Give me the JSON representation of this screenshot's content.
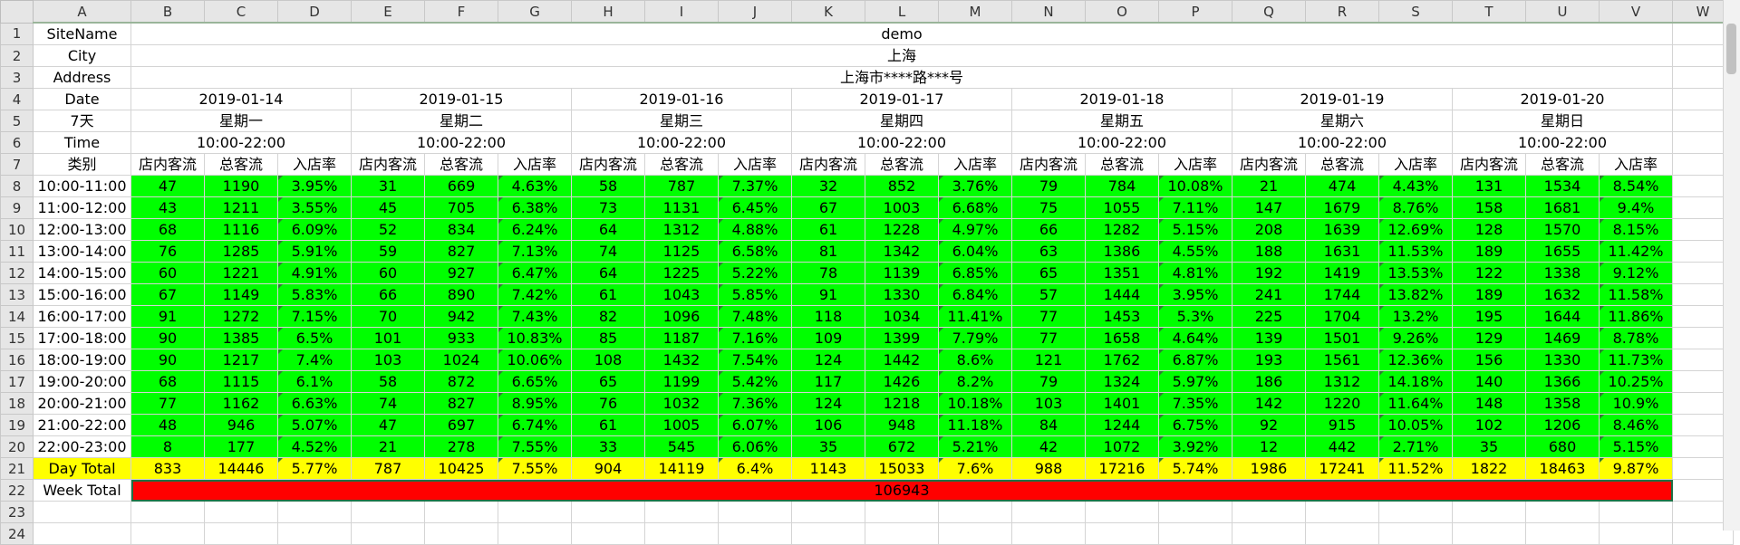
{
  "columns": [
    "A",
    "B",
    "C",
    "D",
    "E",
    "F",
    "G",
    "H",
    "I",
    "J",
    "K",
    "L",
    "M",
    "N",
    "O",
    "P",
    "Q",
    "R",
    "S",
    "T",
    "U",
    "V",
    "W"
  ],
  "row_numbers": [
    1,
    2,
    3,
    4,
    5,
    6,
    7,
    8,
    9,
    10,
    11,
    12,
    13,
    14,
    15,
    16,
    17,
    18,
    19,
    20,
    21,
    22,
    23,
    24
  ],
  "labels": {
    "site_name": "SiteName",
    "city": "City",
    "address": "Address",
    "date": "Date",
    "week_label": "7天",
    "time": "Time",
    "category": "类别",
    "day_total": "Day Total",
    "week_total": "Week Total"
  },
  "site": {
    "name": "demo",
    "city": "上海",
    "address": "上海市****路***号"
  },
  "days": [
    {
      "date": "2019-01-14",
      "weekday": "星期一",
      "hours": "10:00-22:00"
    },
    {
      "date": "2019-01-15",
      "weekday": "星期二",
      "hours": "10:00-22:00"
    },
    {
      "date": "2019-01-16",
      "weekday": "星期三",
      "hours": "10:00-22:00"
    },
    {
      "date": "2019-01-17",
      "weekday": "星期四",
      "hours": "10:00-22:00"
    },
    {
      "date": "2019-01-18",
      "weekday": "星期五",
      "hours": "10:00-22:00"
    },
    {
      "date": "2019-01-19",
      "weekday": "星期六",
      "hours": "10:00-22:00"
    },
    {
      "date": "2019-01-20",
      "weekday": "星期日",
      "hours": "10:00-22:00"
    }
  ],
  "sub_headers": [
    "店内客流",
    "总客流",
    "入店率"
  ],
  "time_slots": [
    {
      "slot": "10:00-11:00",
      "cells": [
        [
          "47",
          "1190",
          "3.95%"
        ],
        [
          "31",
          "669",
          "4.63%"
        ],
        [
          "58",
          "787",
          "7.37%"
        ],
        [
          "32",
          "852",
          "3.76%"
        ],
        [
          "79",
          "784",
          "10.08%"
        ],
        [
          "21",
          "474",
          "4.43%"
        ],
        [
          "131",
          "1534",
          "8.54%"
        ]
      ]
    },
    {
      "slot": "11:00-12:00",
      "cells": [
        [
          "43",
          "1211",
          "3.55%"
        ],
        [
          "45",
          "705",
          "6.38%"
        ],
        [
          "73",
          "1131",
          "6.45%"
        ],
        [
          "67",
          "1003",
          "6.68%"
        ],
        [
          "75",
          "1055",
          "7.11%"
        ],
        [
          "147",
          "1679",
          "8.76%"
        ],
        [
          "158",
          "1681",
          "9.4%"
        ]
      ]
    },
    {
      "slot": "12:00-13:00",
      "cells": [
        [
          "68",
          "1116",
          "6.09%"
        ],
        [
          "52",
          "834",
          "6.24%"
        ],
        [
          "64",
          "1312",
          "4.88%"
        ],
        [
          "61",
          "1228",
          "4.97%"
        ],
        [
          "66",
          "1282",
          "5.15%"
        ],
        [
          "208",
          "1639",
          "12.69%"
        ],
        [
          "128",
          "1570",
          "8.15%"
        ]
      ]
    },
    {
      "slot": "13:00-14:00",
      "cells": [
        [
          "76",
          "1285",
          "5.91%"
        ],
        [
          "59",
          "827",
          "7.13%"
        ],
        [
          "74",
          "1125",
          "6.58%"
        ],
        [
          "81",
          "1342",
          "6.04%"
        ],
        [
          "63",
          "1386",
          "4.55%"
        ],
        [
          "188",
          "1631",
          "11.53%"
        ],
        [
          "189",
          "1655",
          "11.42%"
        ]
      ]
    },
    {
      "slot": "14:00-15:00",
      "cells": [
        [
          "60",
          "1221",
          "4.91%"
        ],
        [
          "60",
          "927",
          "6.47%"
        ],
        [
          "64",
          "1225",
          "5.22%"
        ],
        [
          "78",
          "1139",
          "6.85%"
        ],
        [
          "65",
          "1351",
          "4.81%"
        ],
        [
          "192",
          "1419",
          "13.53%"
        ],
        [
          "122",
          "1338",
          "9.12%"
        ]
      ]
    },
    {
      "slot": "15:00-16:00",
      "cells": [
        [
          "67",
          "1149",
          "5.83%"
        ],
        [
          "66",
          "890",
          "7.42%"
        ],
        [
          "61",
          "1043",
          "5.85%"
        ],
        [
          "91",
          "1330",
          "6.84%"
        ],
        [
          "57",
          "1444",
          "3.95%"
        ],
        [
          "241",
          "1744",
          "13.82%"
        ],
        [
          "189",
          "1632",
          "11.58%"
        ]
      ]
    },
    {
      "slot": "16:00-17:00",
      "cells": [
        [
          "91",
          "1272",
          "7.15%"
        ],
        [
          "70",
          "942",
          "7.43%"
        ],
        [
          "82",
          "1096",
          "7.48%"
        ],
        [
          "118",
          "1034",
          "11.41%"
        ],
        [
          "77",
          "1453",
          "5.3%"
        ],
        [
          "225",
          "1704",
          "13.2%"
        ],
        [
          "195",
          "1644",
          "11.86%"
        ]
      ]
    },
    {
      "slot": "17:00-18:00",
      "cells": [
        [
          "90",
          "1385",
          "6.5%"
        ],
        [
          "101",
          "933",
          "10.83%"
        ],
        [
          "85",
          "1187",
          "7.16%"
        ],
        [
          "109",
          "1399",
          "7.79%"
        ],
        [
          "77",
          "1658",
          "4.64%"
        ],
        [
          "139",
          "1501",
          "9.26%"
        ],
        [
          "129",
          "1469",
          "8.78%"
        ]
      ]
    },
    {
      "slot": "18:00-19:00",
      "cells": [
        [
          "90",
          "1217",
          "7.4%"
        ],
        [
          "103",
          "1024",
          "10.06%"
        ],
        [
          "108",
          "1432",
          "7.54%"
        ],
        [
          "124",
          "1442",
          "8.6%"
        ],
        [
          "121",
          "1762",
          "6.87%"
        ],
        [
          "193",
          "1561",
          "12.36%"
        ],
        [
          "156",
          "1330",
          "11.73%"
        ]
      ]
    },
    {
      "slot": "19:00-20:00",
      "cells": [
        [
          "68",
          "1115",
          "6.1%"
        ],
        [
          "58",
          "872",
          "6.65%"
        ],
        [
          "65",
          "1199",
          "5.42%"
        ],
        [
          "117",
          "1426",
          "8.2%"
        ],
        [
          "79",
          "1324",
          "5.97%"
        ],
        [
          "186",
          "1312",
          "14.18%"
        ],
        [
          "140",
          "1366",
          "10.25%"
        ]
      ]
    },
    {
      "slot": "20:00-21:00",
      "cells": [
        [
          "77",
          "1162",
          "6.63%"
        ],
        [
          "74",
          "827",
          "8.95%"
        ],
        [
          "76",
          "1032",
          "7.36%"
        ],
        [
          "124",
          "1218",
          "10.18%"
        ],
        [
          "103",
          "1401",
          "7.35%"
        ],
        [
          "142",
          "1220",
          "11.64%"
        ],
        [
          "148",
          "1358",
          "10.9%"
        ]
      ]
    },
    {
      "slot": "21:00-22:00",
      "cells": [
        [
          "48",
          "946",
          "5.07%"
        ],
        [
          "47",
          "697",
          "6.74%"
        ],
        [
          "61",
          "1005",
          "6.07%"
        ],
        [
          "106",
          "948",
          "11.18%"
        ],
        [
          "84",
          "1244",
          "6.75%"
        ],
        [
          "92",
          "915",
          "10.05%"
        ],
        [
          "102",
          "1206",
          "8.46%"
        ]
      ]
    },
    {
      "slot": "22:00-23:00",
      "cells": [
        [
          "8",
          "177",
          "4.52%"
        ],
        [
          "21",
          "278",
          "7.55%"
        ],
        [
          "33",
          "545",
          "6.06%"
        ],
        [
          "35",
          "672",
          "5.21%"
        ],
        [
          "42",
          "1072",
          "3.92%"
        ],
        [
          "12",
          "442",
          "2.71%"
        ],
        [
          "35",
          "680",
          "5.15%"
        ]
      ]
    }
  ],
  "day_totals": [
    [
      "833",
      "14446",
      "5.77%"
    ],
    [
      "787",
      "10425",
      "7.55%"
    ],
    [
      "904",
      "14119",
      "6.4%"
    ],
    [
      "1143",
      "15033",
      "7.6%"
    ],
    [
      "988",
      "17216",
      "5.74%"
    ],
    [
      "1986",
      "17241",
      "11.52%"
    ],
    [
      "1822",
      "18463",
      "9.87%"
    ]
  ],
  "week_total": "106943",
  "colors": {
    "data_fill": "#00ff00",
    "total_fill": "#ffff00",
    "week_fill": "#ff0000",
    "header_fill": "#e6e6e6"
  }
}
